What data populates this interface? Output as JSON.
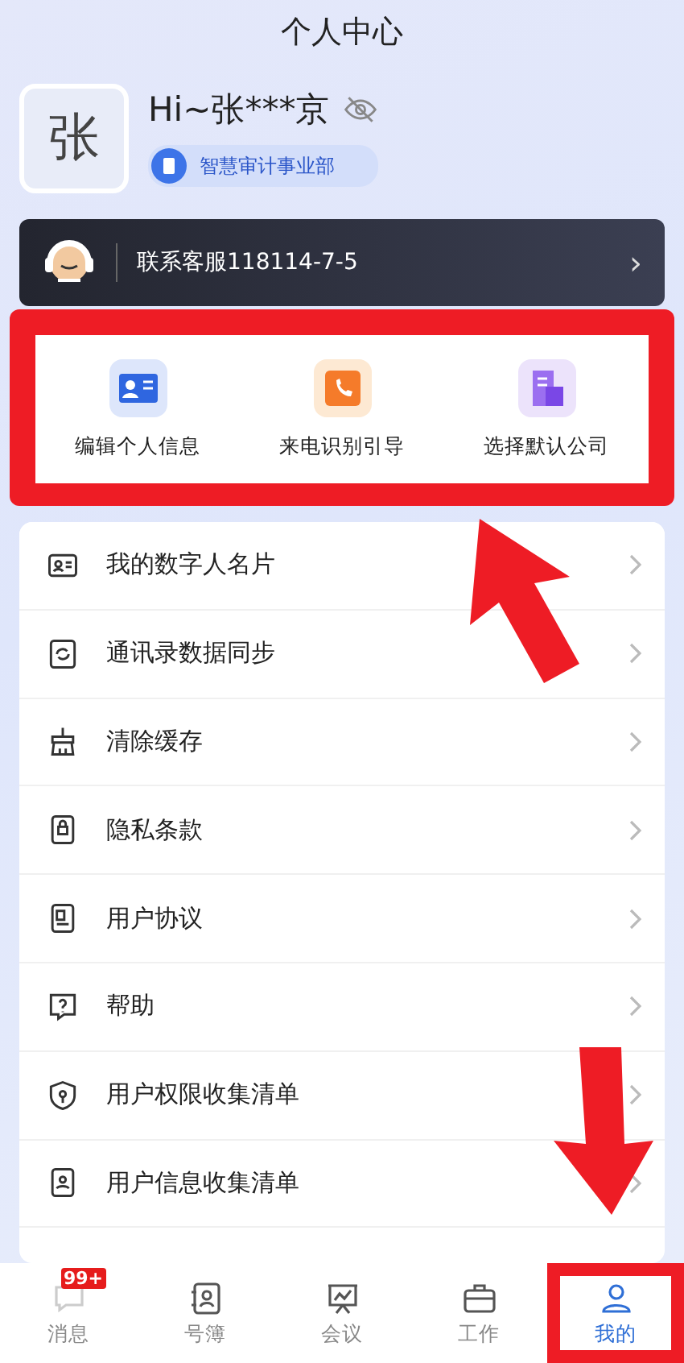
{
  "header": {
    "title": "个人中心"
  },
  "profile": {
    "avatar_text": "张",
    "greeting": "Hi~张***京",
    "department": "智慧审计事业部"
  },
  "service_bar": {
    "label": "联系客服118114-7-5",
    "chevron": "›"
  },
  "quick_actions": [
    {
      "kind": "card",
      "label": "编辑个人信息"
    },
    {
      "kind": "phone",
      "label": "来电识别引导"
    },
    {
      "kind": "building",
      "label": "选择默认公司"
    }
  ],
  "menu": [
    {
      "kind": "card",
      "label": "我的数字人名片"
    },
    {
      "kind": "sync",
      "label": "通讯录数据同步"
    },
    {
      "kind": "broom",
      "label": "清除缓存"
    },
    {
      "kind": "lock",
      "label": "隐私条款"
    },
    {
      "kind": "doc",
      "label": "用户协议"
    },
    {
      "kind": "help",
      "label": "帮助"
    },
    {
      "kind": "shield",
      "label": "用户权限收集清单"
    },
    {
      "kind": "userdoc",
      "label": "用户信息收集清单"
    }
  ],
  "tab_bar": [
    {
      "kind": "chat",
      "label": "消息",
      "badge": "99+",
      "selected": false
    },
    {
      "kind": "contacts",
      "label": "号簿",
      "selected": false
    },
    {
      "kind": "meeting",
      "label": "会议",
      "selected": false
    },
    {
      "kind": "work",
      "label": "工作",
      "selected": false
    },
    {
      "kind": "me",
      "label": "我的",
      "selected": true
    }
  ]
}
